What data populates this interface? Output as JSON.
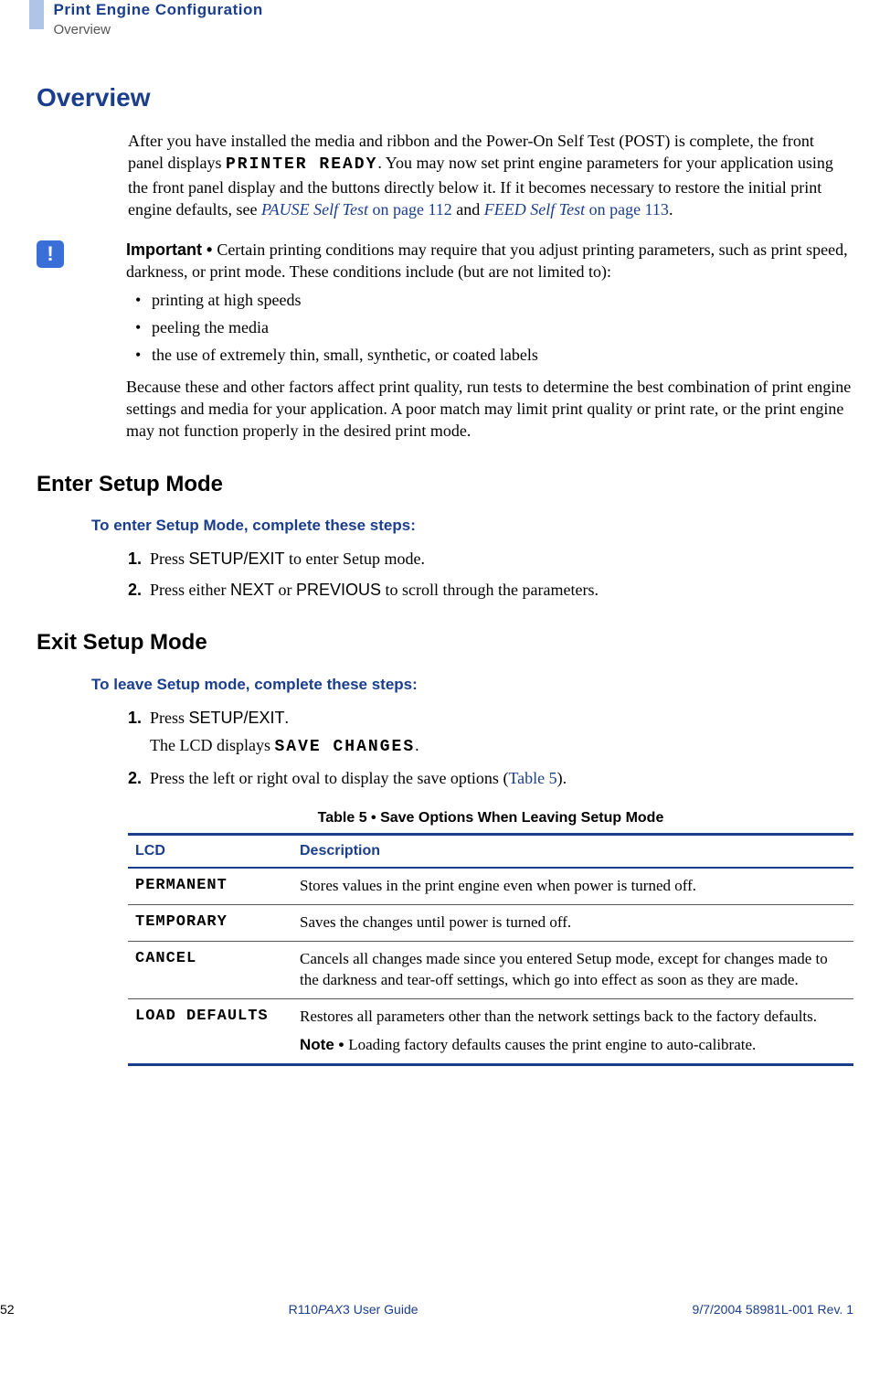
{
  "header": {
    "chapter": "Print Engine Configuration",
    "section": "Overview"
  },
  "h1": "Overview",
  "intro": {
    "p1a": "After you have installed the media and ribbon and the Power-On Self Test (POST) is complete, the front panel displays ",
    "p1_mono": "PRINTER READY",
    "p1b": ". You may now set print engine parameters for your application using the front panel display and the buttons directly below it. If it becomes necessary to restore the initial print engine defaults, see ",
    "link1_i": "PAUSE Self Test",
    "link1_p": " on page 112",
    "p1c": " and ",
    "link2_i": "FEED Self Test",
    "link2_p": " on page 113",
    "p1d": "."
  },
  "important": {
    "icon": "!",
    "label": "Important • ",
    "text": "Certain printing conditions may require that you adjust printing parameters, such as print speed, darkness, or print mode. These conditions include (but are not limited to):",
    "bullets": [
      "printing at high speeds",
      "peeling the media",
      "the use of extremely thin, small, synthetic, or coated labels"
    ],
    "after": "Because these and other factors affect print quality, run tests to determine the best combination of print engine settings and media for your application. A poor match may limit print quality or print rate, or the print engine may not function properly in the desired print mode."
  },
  "enter": {
    "h2": "Enter Setup Mode",
    "h3": "To enter Setup Mode, complete these steps:",
    "steps": [
      {
        "n": "1.",
        "a": "Press ",
        "k": "SETUP/EXIT",
        "b": " to enter Setup mode."
      },
      {
        "n": "2.",
        "a": "Press either ",
        "k": "NEXT",
        "b": " or ",
        "k2": "PREVIOUS",
        "c": " to scroll through the parameters."
      }
    ]
  },
  "exit": {
    "h2": "Exit Setup Mode",
    "h3": "To leave Setup mode, complete these steps:",
    "step1": {
      "n": "1.",
      "a": "Press ",
      "k": "SETUP/EXIT",
      "b": ".",
      "sub_a": "The LCD displays ",
      "sub_m": "SAVE CHANGES",
      "sub_b": "."
    },
    "step2": {
      "n": "2.",
      "a": "Press the left or right oval to display the save options (",
      "ref": "Table 5",
      "b": ")."
    }
  },
  "table": {
    "caption": "Table 5 • Save Options When Leaving Setup Mode",
    "headers": {
      "lcd": "LCD",
      "desc": "Description"
    },
    "rows": [
      {
        "lcd": "PERMANENT",
        "desc": "Stores values in the print engine even when power is turned off."
      },
      {
        "lcd": "TEMPORARY",
        "desc": "Saves the changes until power is turned off."
      },
      {
        "lcd": "CANCEL",
        "desc": "Cancels all changes made since you entered Setup mode, except for changes made to the darkness and tear-off settings, which go into effect as soon as they are made."
      },
      {
        "lcd": "LOAD DEFAULTS",
        "desc": "Restores all parameters other than the network settings back to the factory defaults.",
        "note_label": "Note • ",
        "note": "Loading factory defaults causes the print engine to auto-calibrate."
      }
    ]
  },
  "footer": {
    "page": "52",
    "mid_a": "R110",
    "mid_i": "PAX",
    "mid_b": "3 User Guide",
    "right": "9/7/2004    58981L-001 Rev. 1"
  }
}
